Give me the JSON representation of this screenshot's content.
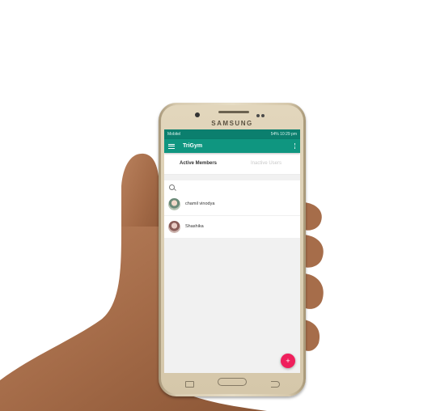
{
  "device": {
    "brand": "SAMSUNG"
  },
  "statusbar": {
    "carrier": "Mobitel",
    "right": "54% 10:29 pm"
  },
  "appbar": {
    "title": "TriGym"
  },
  "tabs": [
    {
      "label": "Active Members",
      "active": true
    },
    {
      "label": "Inactive Users",
      "active": false
    }
  ],
  "search": {
    "placeholder": ""
  },
  "members": [
    {
      "name": "chamil  vinodya",
      "sub": ""
    },
    {
      "name": "Shashika",
      "sub": ""
    }
  ],
  "fab": {
    "icon": "plus-icon",
    "label": "+"
  },
  "colors": {
    "primary": "#0f9680",
    "primary_dark": "#0b7f6e",
    "accent": "#ef1f5c"
  }
}
